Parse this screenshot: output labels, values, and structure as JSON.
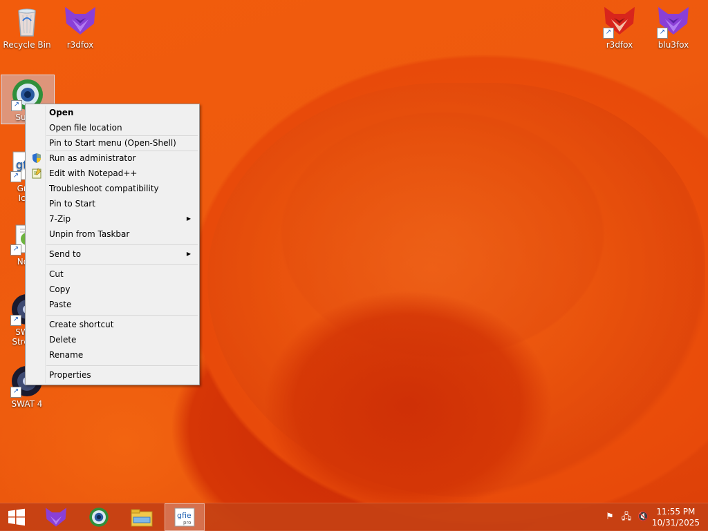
{
  "desktop": {
    "icons": {
      "recycle_bin": "Recycle Bin",
      "r3dfox_left": "r3dfox",
      "r3dfox_right": "r3dfox",
      "blu3fox": "blu3fox",
      "superx": "Super",
      "greenshot": "Gree",
      "greenshot_line2": "Icon",
      "notepad": "Note",
      "swat_stretch": "SWAT",
      "swat_stretch_line2": "Stretch",
      "swat4": "SWAT 4"
    }
  },
  "context_menu": {
    "items": [
      "Open",
      "Open file location",
      "Pin to Start menu (Open-Shell)",
      "Run as administrator",
      "Edit with Notepad++",
      "Troubleshoot compatibility",
      "Pin to Start",
      "7-Zip",
      "Unpin from Taskbar",
      "Send to",
      "Cut",
      "Copy",
      "Paste",
      "Create shortcut",
      "Delete",
      "Rename",
      "Properties"
    ],
    "submenu_arrow": "▶"
  },
  "taskbar": {
    "start_icon": "windows-logo-icon",
    "pinned": [
      "r3dfox-icon",
      "browser-globe-icon",
      "file-explorer-icon",
      "gfie-pro-icon"
    ],
    "tray": [
      "action-center-flag-icon",
      "network-icon",
      "volume-muted-icon"
    ],
    "clock": {
      "time": "11:55 PM",
      "date": "10/31/2025"
    }
  },
  "colors": {
    "wallpaper": "#ee5a0e",
    "taskbar": "#c44014",
    "menu_bg": "#f0f0f0",
    "fox_purple": "#8a3fd6",
    "fox_red": "#d8251c"
  }
}
